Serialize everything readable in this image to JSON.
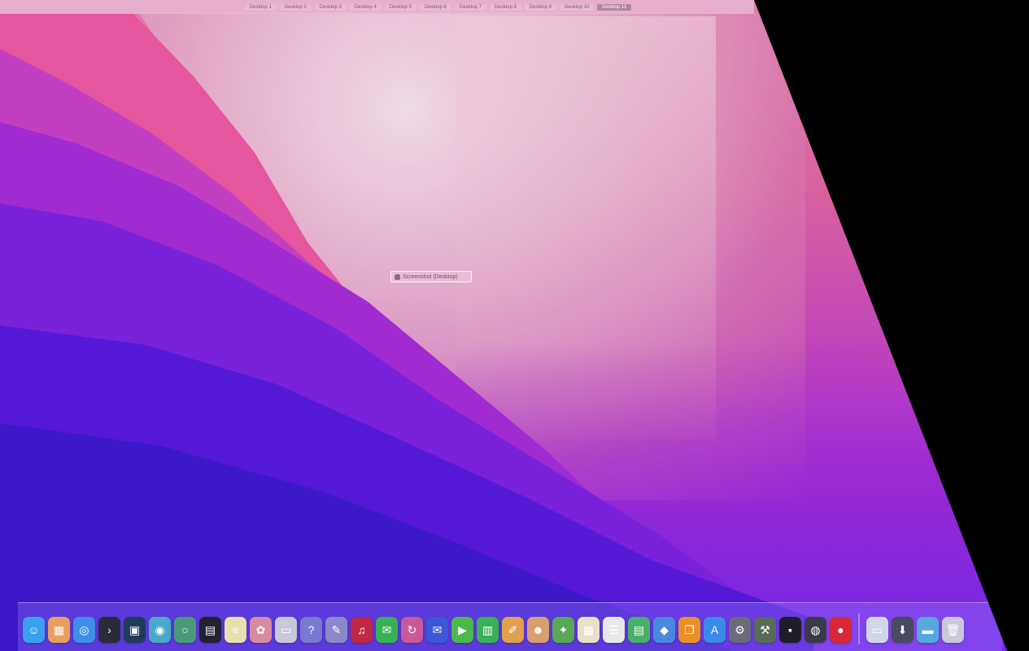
{
  "spaces": [
    {
      "label": "Desktop 1",
      "active": false
    },
    {
      "label": "Desktop 2",
      "active": false
    },
    {
      "label": "Desktop 3",
      "active": false
    },
    {
      "label": "Desktop 4",
      "active": false
    },
    {
      "label": "Desktop 5",
      "active": false
    },
    {
      "label": "Desktop 6",
      "active": false
    },
    {
      "label": "Desktop 7",
      "active": false
    },
    {
      "label": "Desktop 8",
      "active": false
    },
    {
      "label": "Desktop 9",
      "active": false
    },
    {
      "label": "Desktop 10",
      "active": false
    },
    {
      "label": "Desktop 11",
      "active": true
    }
  ],
  "window_label": {
    "text": "Screenshot (Desktop)"
  },
  "dock": {
    "items": [
      {
        "name": "finder-icon",
        "glyph": "☺",
        "color": "#3aa0f0"
      },
      {
        "name": "launchpad-icon",
        "glyph": "▦",
        "color": "#e8a060"
      },
      {
        "name": "safari-icon",
        "glyph": "◎",
        "color": "#3f8fe8"
      },
      {
        "name": "terminal-icon",
        "glyph": "›",
        "color": "#2b2b3a"
      },
      {
        "name": "monitor-icon",
        "glyph": "▣",
        "color": "#1f3d5a"
      },
      {
        "name": "chrome-icon",
        "glyph": "◉",
        "color": "#4aa8c8"
      },
      {
        "name": "ring-icon",
        "glyph": "○",
        "color": "#4a9a7a"
      },
      {
        "name": "activity-icon",
        "glyph": "▤",
        "color": "#222230"
      },
      {
        "name": "notes-icon",
        "glyph": "≡",
        "color": "#e8e0b0"
      },
      {
        "name": "photos-icon",
        "glyph": "✿",
        "color": "#d88aa0"
      },
      {
        "name": "preview-icon",
        "glyph": "▭",
        "color": "#c8c8d8"
      },
      {
        "name": "help-icon",
        "glyph": "?",
        "color": "#7a78d0"
      },
      {
        "name": "pen-icon",
        "glyph": "✎",
        "color": "#8a88c8"
      },
      {
        "name": "music-icon",
        "glyph": "♫",
        "color": "#c02848"
      },
      {
        "name": "messages-icon",
        "glyph": "✉",
        "color": "#38b058"
      },
      {
        "name": "sync-icon",
        "glyph": "↻",
        "color": "#c85a9a"
      },
      {
        "name": "mail-icon",
        "glyph": "✉",
        "color": "#3a58d8"
      },
      {
        "name": "facetime-icon",
        "glyph": "▶",
        "color": "#4ab84a"
      },
      {
        "name": "numbers-icon",
        "glyph": "▥",
        "color": "#3ab058"
      },
      {
        "name": "pages-icon",
        "glyph": "✐",
        "color": "#e0a050"
      },
      {
        "name": "contacts-icon",
        "glyph": "☻",
        "color": "#d8a070"
      },
      {
        "name": "maps-icon",
        "glyph": "✦",
        "color": "#58a858"
      },
      {
        "name": "calendar-icon",
        "glyph": "▦",
        "color": "#e8e0c8"
      },
      {
        "name": "reminders-icon",
        "glyph": "☰",
        "color": "#e8e8e8"
      },
      {
        "name": "spreadsheet-icon",
        "glyph": "▤",
        "color": "#48b068"
      },
      {
        "name": "keynote-icon",
        "glyph": "◆",
        "color": "#4a88e0"
      },
      {
        "name": "books-icon",
        "glyph": "❐",
        "color": "#e8902a"
      },
      {
        "name": "appstore-icon",
        "glyph": "A",
        "color": "#3a8ae8"
      },
      {
        "name": "settings-icon",
        "glyph": "⚙",
        "color": "#6a6a7a"
      },
      {
        "name": "utilities-icon",
        "glyph": "⚒",
        "color": "#5a6a5a"
      },
      {
        "name": "console-icon",
        "glyph": "▪",
        "color": "#1e1e28"
      },
      {
        "name": "disk-icon",
        "glyph": "◍",
        "color": "#3a3a4a"
      },
      {
        "name": "recorder-icon",
        "glyph": "●",
        "color": "#d82838"
      },
      {
        "name": "files-icon",
        "glyph": "▭",
        "color": "#d0d8e8"
      },
      {
        "name": "downloads-icon",
        "glyph": "⬇",
        "color": "#4a4a60"
      },
      {
        "name": "folder-icon",
        "glyph": "▬",
        "color": "#58a8e0"
      },
      {
        "name": "trash-icon",
        "glyph": "🗑",
        "color": "#c8c8d8"
      }
    ]
  }
}
